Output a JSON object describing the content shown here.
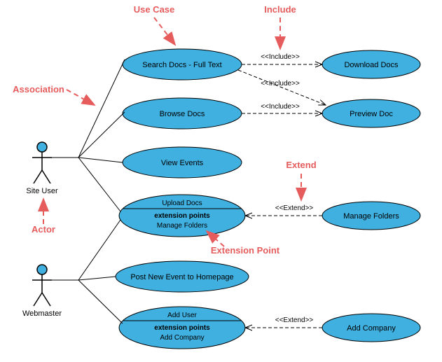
{
  "actors": {
    "a1": "Site User",
    "a2": "Webmaster"
  },
  "usecases": {
    "uc1": "Search Docs - Full Text",
    "uc2": "Browse Docs",
    "uc3": "View Events",
    "uc4": {
      "title": "Upload Docs",
      "ep_header": "extension points",
      "ep": "Manage Folders"
    },
    "uc5": "Post New Event to Homepage",
    "uc6": {
      "title": "Add User",
      "ep_header": "extension points",
      "ep": "Add Company"
    },
    "uc7": "Download Docs",
    "uc8": "Preview Doc",
    "uc9": "Manage Folders",
    "uc10": "Add Company"
  },
  "stereotypes": {
    "inc": "<<Include>>",
    "ext": "<<Extend>>"
  },
  "notes": {
    "usecase": "Use Case",
    "include": "Include",
    "association": "Association",
    "actor": "Actor",
    "extend": "Extend",
    "extpoint": "Extension Point"
  },
  "chart_data": {
    "type": "uml-use-case-diagram",
    "actors": [
      "Site User",
      "Webmaster"
    ],
    "use_cases": [
      "Search Docs - Full Text",
      "Browse Docs",
      "View Events",
      "Upload Docs",
      "Post New Event to Homepage",
      "Add User",
      "Download Docs",
      "Preview Doc",
      "Manage Folders",
      "Add Company"
    ],
    "associations": [
      [
        "Site User",
        "Search Docs - Full Text"
      ],
      [
        "Site User",
        "Browse Docs"
      ],
      [
        "Site User",
        "View Events"
      ],
      [
        "Site User",
        "Upload Docs"
      ],
      [
        "Webmaster",
        "Upload Docs"
      ],
      [
        "Webmaster",
        "Post New Event to Homepage"
      ],
      [
        "Webmaster",
        "Add User"
      ]
    ],
    "include": [
      [
        "Search Docs - Full Text",
        "Download Docs"
      ],
      [
        "Search Docs - Full Text",
        "Preview Doc"
      ],
      [
        "Browse Docs",
        "Preview Doc"
      ]
    ],
    "extend": [
      [
        "Manage Folders",
        "Upload Docs"
      ],
      [
        "Add Company",
        "Add User"
      ]
    ],
    "extension_points": {
      "Upload Docs": [
        "Manage Folders"
      ],
      "Add User": [
        "Add Company"
      ]
    },
    "legend_callouts": [
      "Use Case",
      "Include",
      "Association",
      "Actor",
      "Extend",
      "Extension Point"
    ]
  }
}
